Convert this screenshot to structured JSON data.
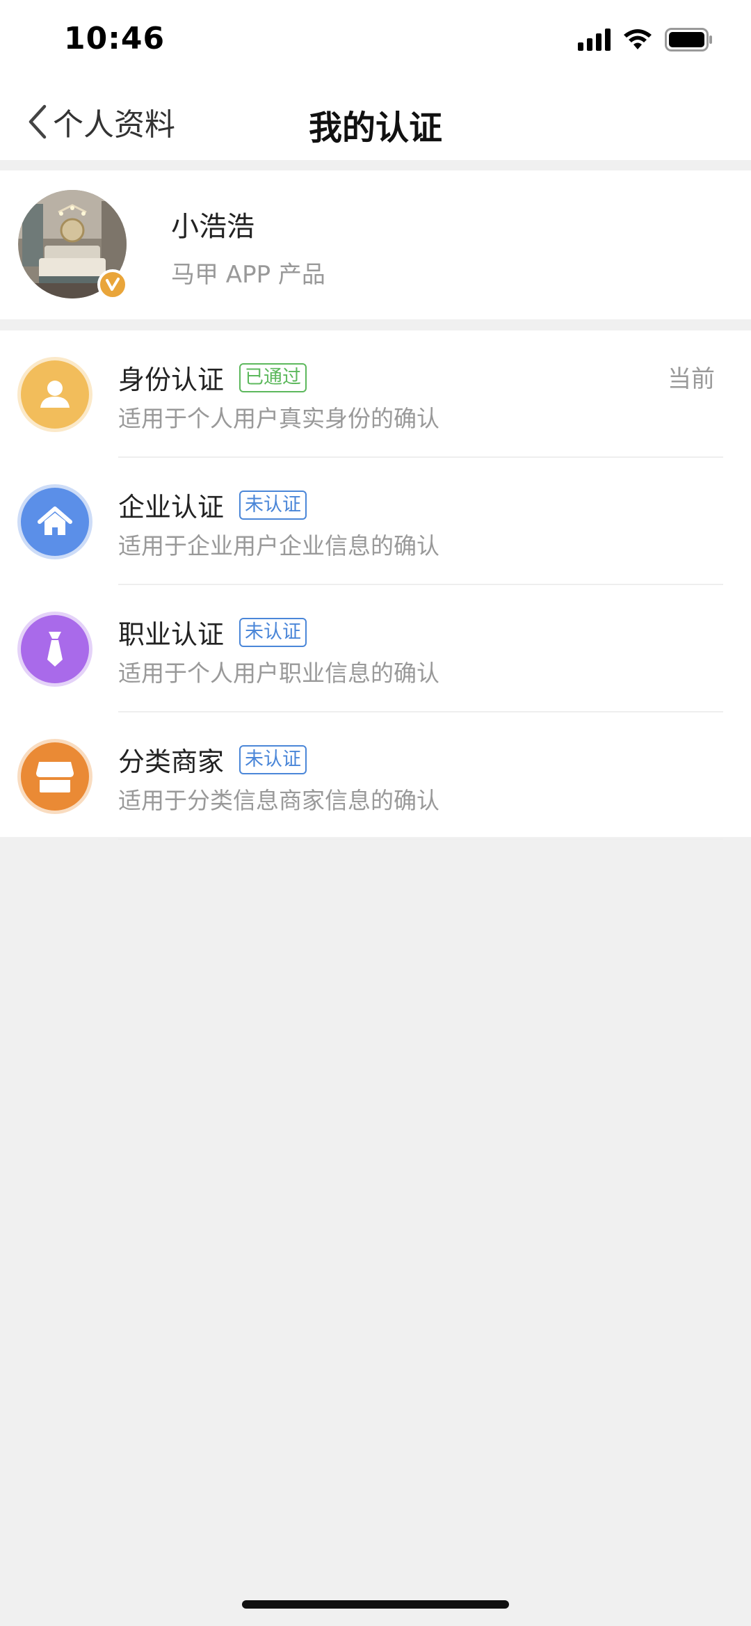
{
  "status": {
    "time": "10:46"
  },
  "nav": {
    "back_label": "个人资料",
    "title": "我的认证"
  },
  "profile": {
    "name": "小浩浩",
    "subtitle": "马甲 APP 产品"
  },
  "colors": {
    "identity": "#f2bd5b",
    "enterprise": "#5b8fe8",
    "profession": "#a96aea",
    "merchant": "#ea8a35",
    "passed": "#5cb85c",
    "unverified": "#4a86d8"
  },
  "certifications": [
    {
      "title": "身份认证",
      "tag": "已通过",
      "desc": "适用于个人用户真实身份的确认",
      "current": "当前",
      "icon": "user-icon"
    },
    {
      "title": "企业认证",
      "tag": "未认证",
      "desc": "适用于企业用户企业信息的确认",
      "icon": "home-icon"
    },
    {
      "title": "职业认证",
      "tag": "未认证",
      "desc": "适用于个人用户职业信息的确认",
      "icon": "tie-icon"
    },
    {
      "title": "分类商家",
      "tag": "未认证",
      "desc": "适用于分类信息商家信息的确认",
      "icon": "store-icon"
    }
  ]
}
